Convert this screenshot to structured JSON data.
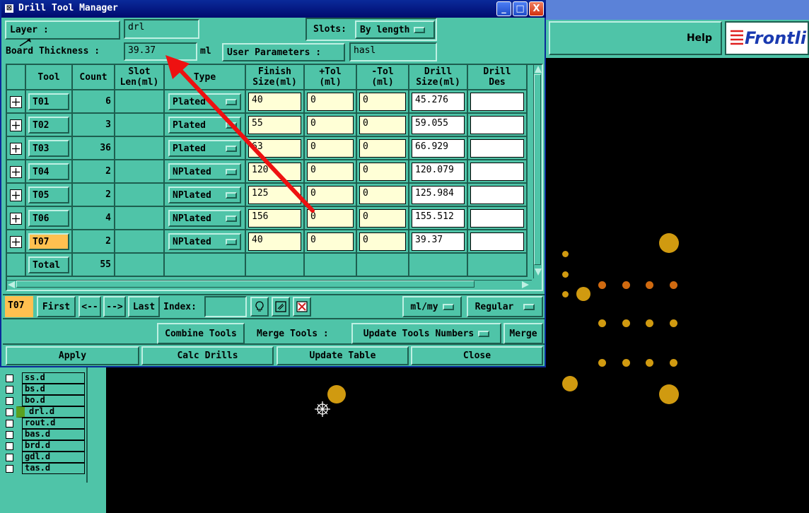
{
  "window": {
    "title": "Drill Tool Manager",
    "min_label": "_",
    "max_label": "□",
    "close_label": "X"
  },
  "background_app": {
    "help_label": "Help",
    "brand_text": "Frontli",
    "layers": [
      "ss.d",
      "bs.d",
      "bo.d",
      "drl.d",
      "rout.d",
      "bas.d",
      "brd.d",
      "gdl.d",
      "tas.d"
    ],
    "active_layer_index": 3
  },
  "form": {
    "layer_label": "Layer          :",
    "layer_value": "drl",
    "slots_label": "Slots:",
    "slots_value": "By length",
    "board_thickness_label": "Board Thickness :",
    "board_thickness_value": "39.37",
    "board_thickness_unit": "ml",
    "user_params_label": "User Parameters :",
    "user_params_value": "hasl"
  },
  "table": {
    "headers": {
      "tool": "Tool",
      "count": "Count",
      "slot": "Slot\nLen(ml)",
      "type": "Type",
      "finish": "Finish\nSize(ml)",
      "ptol": "+Tol\n(ml)",
      "ntol": "-Tol\n(ml)",
      "drill": "Drill\nSize(ml)",
      "des": "Drill\nDes"
    },
    "rows": [
      {
        "tool": "T01",
        "count": "6",
        "type": "Plated",
        "finish": "40",
        "ptol": "0",
        "ntol": "0",
        "drill": "45.276",
        "des": ""
      },
      {
        "tool": "T02",
        "count": "3",
        "type": "Plated",
        "finish": "55",
        "ptol": "0",
        "ntol": "0",
        "drill": "59.055",
        "des": ""
      },
      {
        "tool": "T03",
        "count": "36",
        "type": "Plated",
        "finish": "63",
        "ptol": "0",
        "ntol": "0",
        "drill": "66.929",
        "des": ""
      },
      {
        "tool": "T04",
        "count": "2",
        "type": "NPlated",
        "finish": "120",
        "ptol": "0",
        "ntol": "0",
        "drill": "120.079",
        "des": ""
      },
      {
        "tool": "T05",
        "count": "2",
        "type": "NPlated",
        "finish": "125",
        "ptol": "0",
        "ntol": "0",
        "drill": "125.984",
        "des": ""
      },
      {
        "tool": "T06",
        "count": "4",
        "type": "NPlated",
        "finish": "156",
        "ptol": "0",
        "ntol": "0",
        "drill": "155.512",
        "des": ""
      },
      {
        "tool": "T07",
        "count": "2",
        "type": "NPlated",
        "finish": "40",
        "ptol": "0",
        "ntol": "0",
        "drill": "39.37",
        "des": ""
      }
    ],
    "selected_row": 6,
    "total_label": "Total",
    "total_count": "55"
  },
  "nav": {
    "current_tool": "T07",
    "first": "First",
    "prev": "<--",
    "next": "-->",
    "last": "Last",
    "index_label": "Index:",
    "index_value": "",
    "units_value": "ml/my",
    "mode_value": "Regular"
  },
  "actions": {
    "combine": "Combine Tools",
    "merge_label": "Merge Tools :",
    "update_numbers": "Update Tools Numbers",
    "merge": "Merge",
    "apply": "Apply",
    "calc": "Calc Drills",
    "update_table": "Update Table",
    "close": "Close"
  },
  "colors": {
    "panel": "#4fc4a8",
    "title_bar": "#0a2a9a",
    "selected_tool": "#ffc050",
    "field_yellow": "#ffffd6",
    "annotation_arrow": "#ee1111",
    "pad": "#d09a10"
  }
}
